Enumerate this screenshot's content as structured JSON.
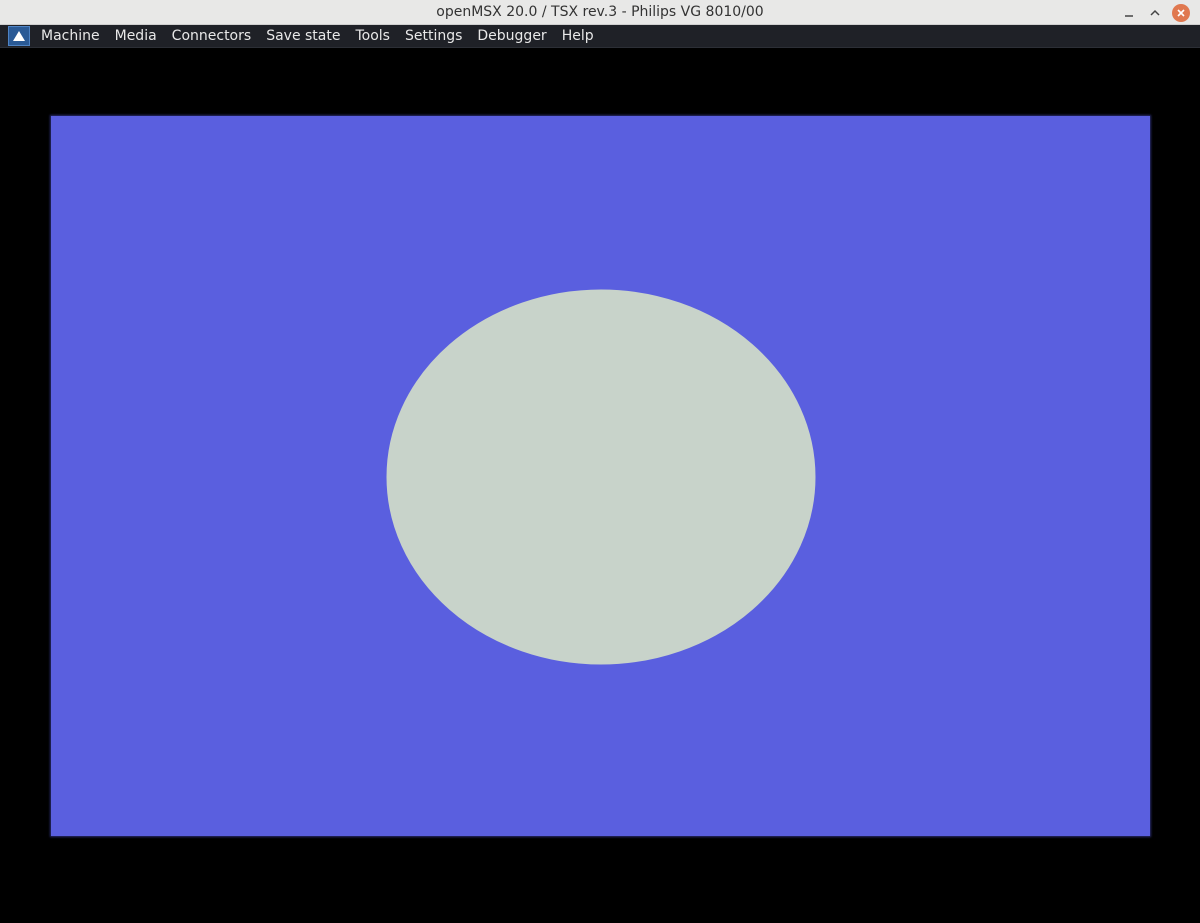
{
  "window": {
    "title": "openMSX 20.0 / TSX rev.3 - Philips VG 8010/00"
  },
  "titlebar_icons": {
    "minimize": "minimize-icon",
    "maximize": "maximize-icon",
    "close": "close-icon"
  },
  "app_icon": "openmsx-logo-icon",
  "menu": {
    "items": [
      {
        "label": "Machine"
      },
      {
        "label": "Media"
      },
      {
        "label": "Connectors"
      },
      {
        "label": "Save state"
      },
      {
        "label": "Tools"
      },
      {
        "label": "Settings"
      },
      {
        "label": "Debugger"
      },
      {
        "label": "Help"
      }
    ]
  },
  "colors": {
    "screen_background": "#5a5fdf",
    "ellipse_fill": "#c8d3ca",
    "border": "#000000",
    "menubar": "#1f2127",
    "titlebar": "#e8e8e7",
    "close_button": "#e0784f"
  }
}
